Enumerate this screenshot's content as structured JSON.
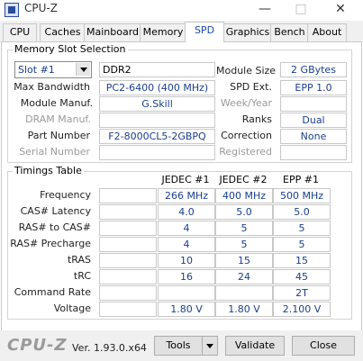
{
  "window": {
    "title": "CPU-Z",
    "minimize": "—",
    "maximize": "□",
    "close": "✕"
  },
  "tabs": [
    {
      "label": "CPU"
    },
    {
      "label": "Caches"
    },
    {
      "label": "Mainboard"
    },
    {
      "label": "Memory"
    },
    {
      "label": "SPD"
    },
    {
      "label": "Graphics"
    },
    {
      "label": "Bench"
    },
    {
      "label": "About"
    }
  ],
  "active_tab": "SPD",
  "slot": {
    "group_title": "Memory Slot Selection",
    "selected": "Slot #1",
    "type": "DDR2",
    "max_bandwidth_label": "Max Bandwidth",
    "max_bandwidth": "PC2-6400 (400 MHz)",
    "module_manuf_label": "Module Manuf.",
    "module_manuf": "G.Skill",
    "dram_manuf_label": "DRAM Manuf.",
    "dram_manuf": "",
    "part_number_label": "Part Number",
    "part_number": "F2-8000CL5-2GBPQ",
    "serial_number_label": "Serial Number",
    "serial_number": "",
    "module_size_label": "Module Size",
    "module_size": "2 GBytes",
    "spd_ext_label": "SPD Ext.",
    "spd_ext": "EPP 1.0",
    "week_year_label": "Week/Year",
    "week_year": "",
    "ranks_label": "Ranks",
    "ranks": "Dual",
    "correction_label": "Correction",
    "correction": "None",
    "registered_label": "Registered",
    "registered": ""
  },
  "timings": {
    "group_title": "Timings Table",
    "columns": [
      "JEDEC #1",
      "JEDEC #2",
      "EPP #1"
    ],
    "rows": [
      {
        "label": "Frequency",
        "values": [
          "266 MHz",
          "400 MHz",
          "500 MHz"
        ]
      },
      {
        "label": "CAS# Latency",
        "values": [
          "4.0",
          "5.0",
          "5.0"
        ]
      },
      {
        "label": "RAS# to CAS#",
        "values": [
          "4",
          "5",
          "5"
        ]
      },
      {
        "label": "RAS# Precharge",
        "values": [
          "4",
          "5",
          "5"
        ]
      },
      {
        "label": "tRAS",
        "values": [
          "10",
          "15",
          "15"
        ]
      },
      {
        "label": "tRC",
        "values": [
          "16",
          "24",
          "45"
        ]
      },
      {
        "label": "Command Rate",
        "values": [
          "",
          "",
          "2T"
        ]
      },
      {
        "label": "Voltage",
        "values": [
          "1.80 V",
          "1.80 V",
          "2.100 V"
        ]
      }
    ]
  },
  "footer": {
    "logo": "CPU-Z",
    "version": "Ver. 1.93.0.x64",
    "tools_label": "Tools",
    "validate_label": "Validate",
    "close_label": "Close"
  }
}
